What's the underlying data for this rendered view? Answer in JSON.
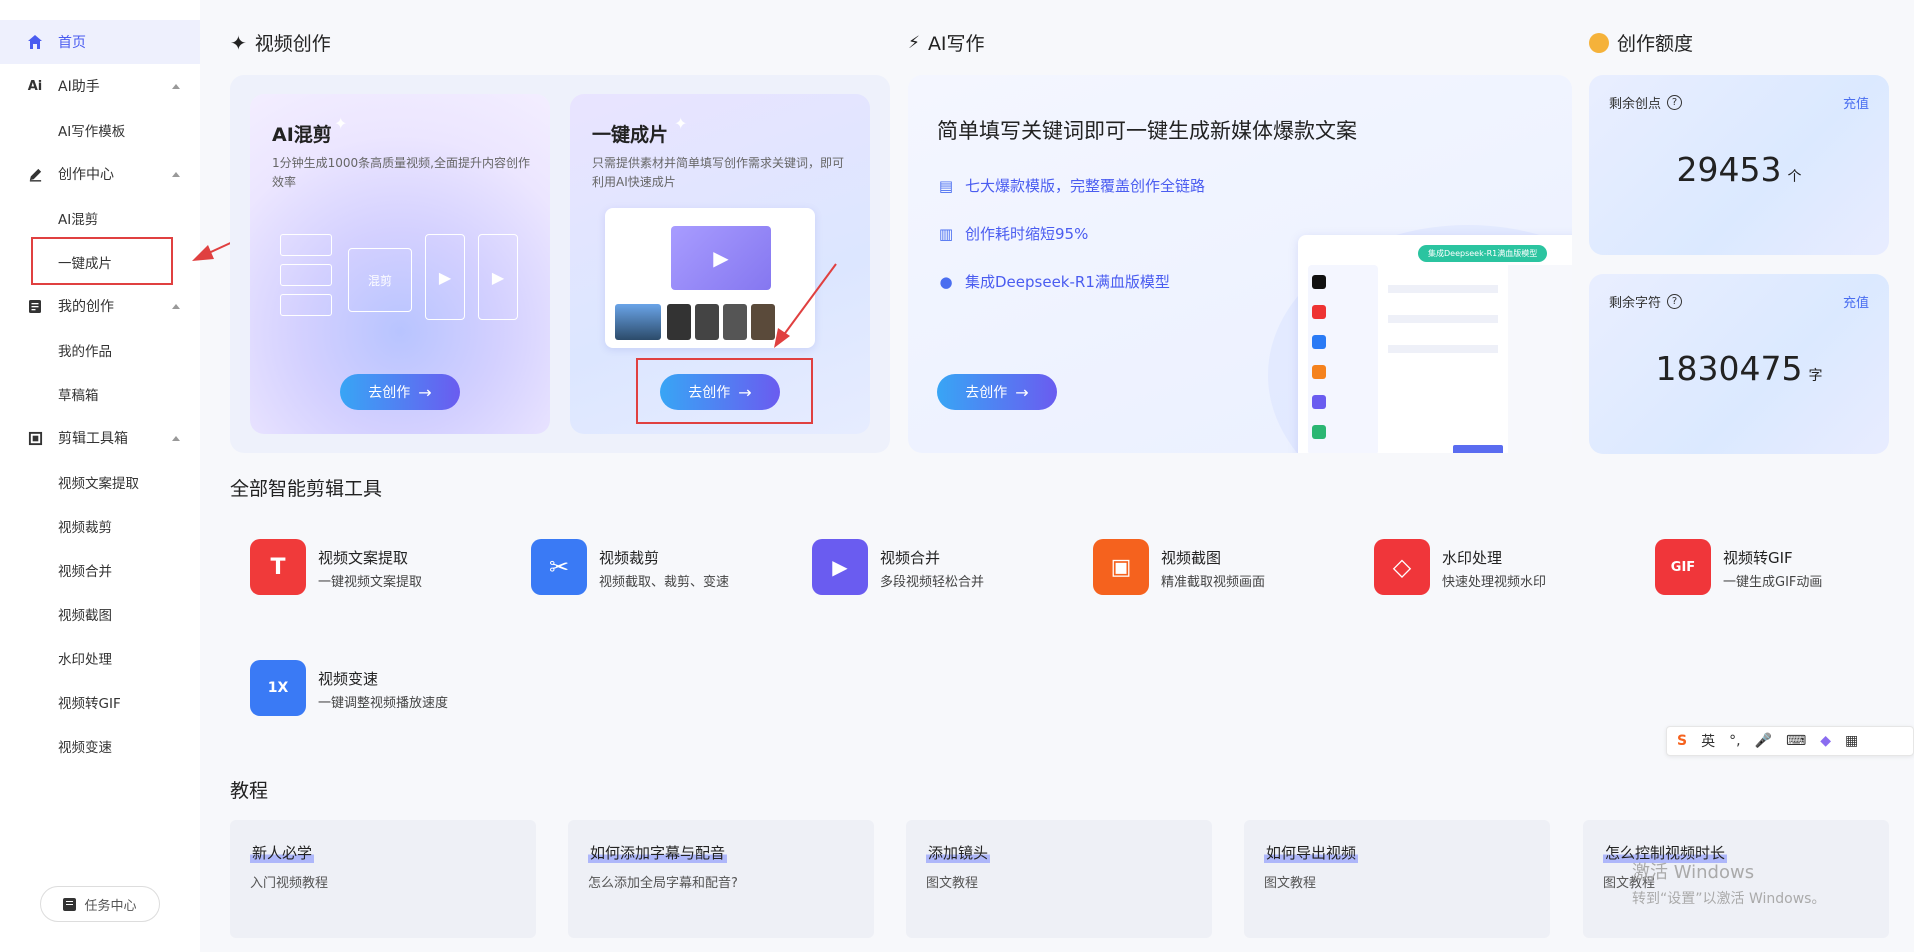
{
  "sidebar": {
    "items": [
      {
        "label": "首页",
        "icon": "home-icon",
        "active": true
      },
      {
        "label": "AI助手",
        "icon": "ai-icon"
      },
      {
        "label": "AI写作模板"
      },
      {
        "label": "创作中心",
        "icon": "pen-icon"
      },
      {
        "label": "AI混剪"
      },
      {
        "label": "一键成片"
      },
      {
        "label": "我的创作",
        "icon": "document-icon"
      },
      {
        "label": "我的作品"
      },
      {
        "label": "草稿箱"
      },
      {
        "label": "剪辑工具箱",
        "icon": "crop-icon"
      },
      {
        "label": "视频文案提取"
      },
      {
        "label": "视频裁剪"
      },
      {
        "label": "视频合并"
      },
      {
        "label": "视频截图"
      },
      {
        "label": "水印处理"
      },
      {
        "label": "视频转GIF"
      },
      {
        "label": "视频变速"
      }
    ],
    "task_center": "任务中心"
  },
  "video": {
    "title": "视频创作",
    "mix": {
      "title": "AI混剪",
      "desc": "1分钟生成1000条高质量视频,全面提升内容创作效率",
      "button": "去创作",
      "center_label": "混剪"
    },
    "oneclick": {
      "title": "一键成片",
      "desc": "只需提供素材并简单填写创作需求关键词，即可利用AI快速成片",
      "button": "去创作"
    }
  },
  "writing": {
    "title": "AI写作",
    "headline": "简单填写关键词即可一键生成新媒体爆款文案",
    "features": [
      "七大爆款模版，完整覆盖创作全链路",
      "创作耗时缩短95%",
      "集成Deepseek-R1满血版模型"
    ],
    "button": "去创作",
    "preview_badge": "集成Deepseek-R1满血版模型"
  },
  "quota": {
    "title": "创作额度",
    "points": {
      "label": "剩余创点",
      "value": "29453",
      "unit": "个",
      "recharge": "充值"
    },
    "chars": {
      "label": "剩余字符",
      "value": "1830475",
      "unit": "字",
      "recharge": "充值"
    }
  },
  "tools": {
    "title": "全部智能剪辑工具",
    "items": [
      {
        "name": "视频文案提取",
        "desc": "一键视频文案提取",
        "color": "#f03a3a",
        "glyph": "T"
      },
      {
        "name": "视频裁剪",
        "desc": "视频截取、裁剪、变速",
        "color": "#3a7af5",
        "glyph": "✂"
      },
      {
        "name": "视频合并",
        "desc": "多段视频轻松合并",
        "color": "#6a5cf0",
        "glyph": "▶"
      },
      {
        "name": "视频截图",
        "desc": "精准截取视频画面",
        "color": "#f5621e",
        "glyph": "▣"
      },
      {
        "name": "水印处理",
        "desc": "快速处理视频水印",
        "color": "#f0363a",
        "glyph": "◇"
      },
      {
        "name": "视频转GIF",
        "desc": "一键生成GIF动画",
        "color": "#f0363a",
        "glyph": "GIF"
      },
      {
        "name": "视频变速",
        "desc": "一键调整视频播放速度",
        "color": "#3a7af5",
        "glyph": "1X"
      }
    ]
  },
  "tutorials": {
    "title": "教程",
    "items": [
      {
        "title": "新人必学",
        "desc": "入门视频教程"
      },
      {
        "title": "如何添加字幕与配音",
        "desc": "怎么添加全局字幕和配音?"
      },
      {
        "title": "添加镜头",
        "desc": "图文教程"
      },
      {
        "title": "如何导出视频",
        "desc": "图文教程"
      },
      {
        "title": "怎么控制视频时长",
        "desc": "图文教程"
      }
    ]
  },
  "ime": {
    "lang": "英"
  },
  "watermark": {
    "line1": "激活 Windows",
    "line2": "转到“设置”以激活 Windows。"
  }
}
